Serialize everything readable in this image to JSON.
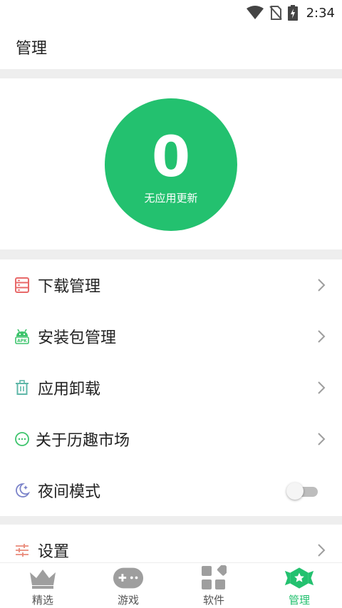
{
  "status_bar": {
    "time": "2:34"
  },
  "app_bar": {
    "title": "管理"
  },
  "summary": {
    "count": "0",
    "caption": "无应用更新"
  },
  "menu": [
    {
      "label": "下载管理",
      "icon": "download-list-icon"
    },
    {
      "label": "安装包管理",
      "icon": "android-apk-icon"
    },
    {
      "label": "应用卸载",
      "icon": "trash-icon"
    },
    {
      "label": "关于历趣市场",
      "icon": "chat-bubble-icon"
    },
    {
      "label": "夜间模式",
      "icon": "moon-icon",
      "toggle": false
    },
    {
      "label": "设置",
      "icon": "sliders-icon"
    }
  ],
  "bottom_nav": [
    {
      "label": "精选",
      "icon": "crown-icon",
      "active": false
    },
    {
      "label": "游戏",
      "icon": "gamepad-icon",
      "active": false
    },
    {
      "label": "软件",
      "icon": "apps-grid-icon",
      "active": false
    },
    {
      "label": "管理",
      "icon": "manage-badge-icon",
      "active": true
    }
  ],
  "colors": {
    "accent": "#23c16f",
    "download_icon": "#e86a6a",
    "apk_icon": "#3ec46d",
    "trash_icon": "#5fb7a8",
    "about_icon": "#3ec46d",
    "moon_icon": "#7a82c9",
    "settings_icon": "#e98a7a"
  }
}
